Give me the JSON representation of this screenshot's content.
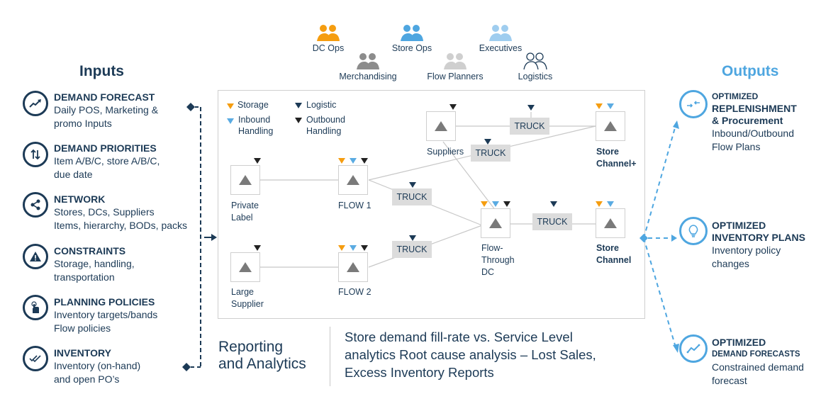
{
  "personas": [
    {
      "label": "DC Ops",
      "icon": "people-icon",
      "color": "#f59d10"
    },
    {
      "label": "Store Ops",
      "icon": "people-icon",
      "color": "#4ea6e0"
    },
    {
      "label": "Executives",
      "icon": "people-icon",
      "color": "#9fcdef"
    },
    {
      "label": "Merchandising",
      "icon": "people-icon",
      "color": "#8c8c8c"
    },
    {
      "label": "Flow Planners",
      "icon": "people-icon",
      "color": "#cfcfcf"
    },
    {
      "label": "Logistics",
      "icon": "people-outline-icon",
      "color": "#1c3a56"
    }
  ],
  "inputs": {
    "heading": "Inputs",
    "items": [
      {
        "title": "DEMAND FORECAST",
        "desc1": "Daily POS, Marketing &",
        "desc2": "promo Inputs",
        "icon": "trend-up-icon"
      },
      {
        "title": "DEMAND PRIORITIES",
        "desc1": "Item A/B/C, store A/B/C,",
        "desc2": "due date",
        "icon": "sort-arrows-icon"
      },
      {
        "title": "NETWORK",
        "desc1": "Stores, DCs, Suppliers",
        "desc2": "Items, hierarchy, BODs, packs",
        "icon": "share-icon"
      },
      {
        "title": "CONSTRAINTS",
        "desc1": "Storage, handling,",
        "desc2": "transportation",
        "icon": "warning-icon"
      },
      {
        "title": "PLANNING POLICIES",
        "desc1": "Inventory targets/bands",
        "desc2": "Flow policies",
        "icon": "hand-pointer-icon"
      },
      {
        "title": "INVENTORY",
        "desc1": "Inventory (on-hand)",
        "desc2": "and open PO’s",
        "icon": "double-check-icon"
      }
    ]
  },
  "legend": {
    "storage": "Storage",
    "inbound1": "Inbound",
    "inbound2": "Handling",
    "logistic": "Logistic",
    "outbound1": "Outbound",
    "outbound2": "Handling",
    "colors": {
      "storage": "#f59d10",
      "inbound": "#5aabe2",
      "logistic": "#1c3a56",
      "outbound": "#222222"
    }
  },
  "network": {
    "nodes": [
      {
        "id": "private-label",
        "label1": "Private",
        "label2": "Label"
      },
      {
        "id": "flow1",
        "label1": "FLOW 1",
        "label2": ""
      },
      {
        "id": "large-supplier",
        "label1": "Large",
        "label2": "Supplier"
      },
      {
        "id": "flow2",
        "label1": "FLOW 2",
        "label2": ""
      },
      {
        "id": "suppliers",
        "label1": "Suppliers",
        "label2": ""
      },
      {
        "id": "flow-through-dc",
        "label1": "Flow-",
        "label2": "Through",
        "label3": "DC"
      },
      {
        "id": "store-channel-plus",
        "label1": "Store",
        "label2": "Channel+"
      },
      {
        "id": "store-channel",
        "label1": "Store",
        "label2": "Channel"
      }
    ],
    "truck_label": "TRUCK"
  },
  "reporting": {
    "title1": "Reporting",
    "title2": "and Analytics",
    "line1": "Store demand fill-rate vs. Service Level",
    "line2": "analytics Root cause analysis – Lost Sales,",
    "line3": "Excess Inventory Reports"
  },
  "outputs": {
    "heading": "Outputs",
    "items": [
      {
        "title1": "OPTIMIZED",
        "title2": "REPLENISHMENT",
        "title3": "& Procurement",
        "desc1": "Inbound/Outbound",
        "desc2": "Flow Plans",
        "icon": "arrows-converge-icon"
      },
      {
        "title1": "OPTIMIZED",
        "title2": "INVENTORY PLANS",
        "desc1": "Inventory policy",
        "desc2": "changes",
        "icon": "lightbulb-icon"
      },
      {
        "title1": "OPTIMIZED",
        "title2": "DEMAND FORECASTS",
        "desc1": "Constrained demand",
        "desc2": "forecast",
        "icon": "trend-line-icon"
      }
    ]
  }
}
